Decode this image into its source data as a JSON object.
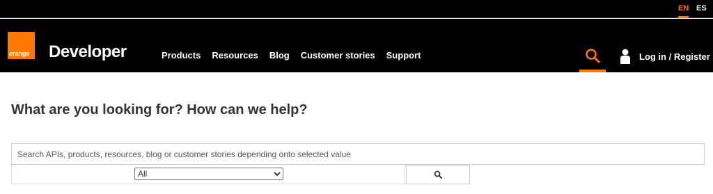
{
  "language_bar": {
    "languages": [
      {
        "code": "EN",
        "active": true
      },
      {
        "code": "ES",
        "active": false
      }
    ]
  },
  "header": {
    "logo_text": "orange",
    "brand": "Developer",
    "nav": [
      "Products",
      "Resources",
      "Blog",
      "Customer stories",
      "Support"
    ],
    "search_icon": "search-icon",
    "user_icon": "user-icon",
    "login_label": "Log in / Register"
  },
  "main": {
    "title": "What are you looking for? How can we help?",
    "search": {
      "placeholder": "Search APIs, products, resources, blog or customer stories depending onto selected value",
      "value": ""
    },
    "filter": {
      "selected": "All"
    },
    "search_button_icon": "search-icon"
  },
  "colors": {
    "accent": "#ff7900",
    "header_bg": "#000000",
    "text": "#333333"
  }
}
